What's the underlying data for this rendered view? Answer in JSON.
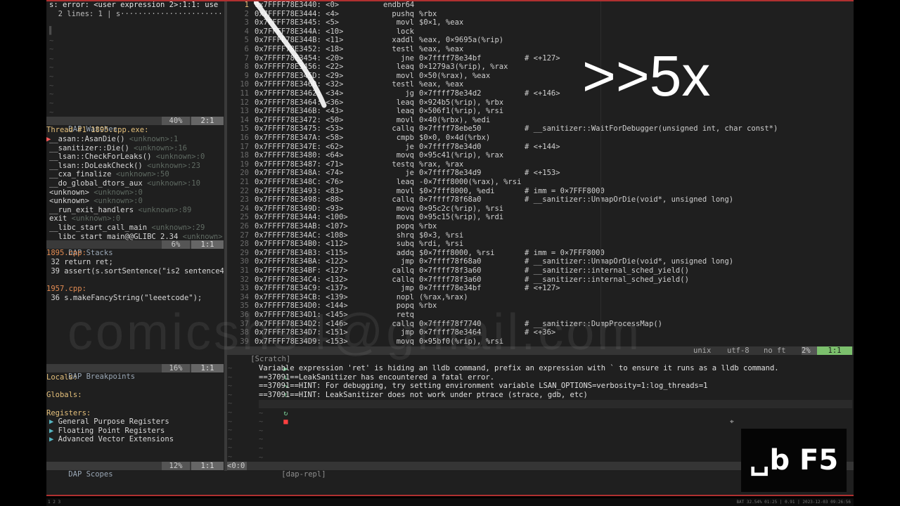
{
  "left_top": {
    "header": "s: error: <user expression 2>:1:1: use",
    "header2": "  2 lines: 1 | s·······················"
  },
  "watches": {
    "title": "DAP Watches",
    "pct": "40%",
    "pos": "2:1",
    "thread": "Thread #1 1895.cpp.exe:",
    "frames": [
      {
        "name": "__asan::AsanDie()",
        "loc": "<unknown>:1"
      },
      {
        "name": "__sanitizer::Die()",
        "loc": "<unknown>:16"
      },
      {
        "name": "__lsan::CheckForLeaks()",
        "loc": "<unknown>:0"
      },
      {
        "name": "__lsan::DoLeakCheck()",
        "loc": "<unknown>:23"
      },
      {
        "name": "__cxa_finalize",
        "loc": "<unknown>:50"
      },
      {
        "name": "__do_global_dtors_aux",
        "loc": "<unknown>:10"
      },
      {
        "name": "<unknown>",
        "loc": "<unknown>:0"
      },
      {
        "name": "<unknown>",
        "loc": "<unknown>:0"
      },
      {
        "name": "__run_exit_handlers",
        "loc": "<unknown>:89"
      },
      {
        "name": "exit",
        "loc": "<unknown>:0"
      },
      {
        "name": "__libc_start_call_main",
        "loc": "<unknown>:29"
      },
      {
        "name": "__libc_start_main@@GLIBC_2.34",
        "loc": "<unknown>"
      }
    ]
  },
  "stacks": {
    "title": "DAP Stacks",
    "pct": "6%",
    "pos": "1:1",
    "file1": "1895.cpp:",
    "l1": " 32 return ret;",
    "l2": " 39 assert(s.sortSentence(\"is2 sentence4",
    "file2": "1957.cpp:",
    "l3": " 36 s.makeFancyString(\"leeetcode\");"
  },
  "breakpoints": {
    "title": "DAP Breakpoints",
    "pct": "16%",
    "pos": "1:1",
    "locals": "Locals:",
    "globals": "Globals:",
    "registers": "Registers:",
    "reg_items": [
      "General Purpose Registers",
      "Floating Point Registers",
      "Advanced Vector Extensions"
    ]
  },
  "scopes": {
    "title": "DAP Scopes",
    "pct": "12%",
    "pos": "1:1",
    "small": "<0:0"
  },
  "disasm": {
    "lines": [
      {
        "n": "1",
        "addr": "0x7FFFF78E3440: <0>",
        "instr": "endbr64",
        "ops": "",
        "cmt": ""
      },
      {
        "n": "2",
        "addr": "0x7FFFF78E3444: <4>",
        "instr": "pushq",
        "ops": "%rbx",
        "cmt": ""
      },
      {
        "n": "3",
        "addr": "0x7FFFF78E3445: <5>",
        "instr": "movl",
        "ops": "$0×1, %eax",
        "cmt": ""
      },
      {
        "n": "4",
        "addr": "0x7FFFF78E344A: <10>",
        "instr": "lock",
        "ops": "",
        "cmt": ""
      },
      {
        "n": "5",
        "addr": "0x7FFFF78E344B: <11>",
        "instr": "xaddl",
        "ops": "%eax, 0×9695a(%rip)",
        "cmt": ""
      },
      {
        "n": "6",
        "addr": "0x7FFFF78E3452: <18>",
        "instr": "testl",
        "ops": "%eax, %eax",
        "cmt": ""
      },
      {
        "n": "7",
        "addr": "0x7FFFF78E3454: <20>",
        "instr": "jne",
        "ops": "0×7ffff78e34bf",
        "cmt": "# <+127>"
      },
      {
        "n": "8",
        "addr": "0x7FFFF78E3456: <22>",
        "instr": "leaq",
        "ops": "0×1279a3(%rip), %rax",
        "cmt": ""
      },
      {
        "n": "9",
        "addr": "0x7FFFF78E345D: <29>",
        "instr": "movl",
        "ops": "0×50(%rax), %eax",
        "cmt": ""
      },
      {
        "n": "10",
        "addr": "0x7FFFF78E3460: <32>",
        "instr": "testl",
        "ops": "%eax, %eax",
        "cmt": ""
      },
      {
        "n": "11",
        "addr": "0x7FFFF78E3462: <34>",
        "instr": "jg",
        "ops": "0×7ffff78e34d2",
        "cmt": "# <+146>"
      },
      {
        "n": "12",
        "addr": "0x7FFFF78E3464: <36>",
        "instr": "leaq",
        "ops": "0×924b5(%rip), %rbx",
        "cmt": ""
      },
      {
        "n": "13",
        "addr": "0x7FFFF78E346B: <43>",
        "instr": "leaq",
        "ops": "0×506f1(%rip), %rsi",
        "cmt": ""
      },
      {
        "n": "14",
        "addr": "0x7FFFF78E3472: <50>",
        "instr": "movl",
        "ops": "0×40(%rbx), %edi",
        "cmt": ""
      },
      {
        "n": "15",
        "addr": "0x7FFFF78E3475: <53>",
        "instr": "callq",
        "ops": "0×7ffff78ebe50",
        "cmt": "# __sanitizer::WaitForDebugger(unsigned int, char const*)"
      },
      {
        "n": "16",
        "addr": "0x7FFFF78E347A: <58>",
        "instr": "cmpb",
        "ops": "$0×0, 0×4d(%rbx)",
        "cmt": ""
      },
      {
        "n": "17",
        "addr": "0x7FFFF78E347E: <62>",
        "instr": "je",
        "ops": "0×7ffff78e34d0",
        "cmt": "# <+144>"
      },
      {
        "n": "18",
        "addr": "0x7FFFF78E3480: <64>",
        "instr": "movq",
        "ops": "0×95c41(%rip), %rax",
        "cmt": ""
      },
      {
        "n": "19",
        "addr": "0x7FFFF78E3487: <71>",
        "instr": "testq",
        "ops": "%rax, %rax",
        "cmt": ""
      },
      {
        "n": "20",
        "addr": "0x7FFFF78E348A: <74>",
        "instr": "je",
        "ops": "0×7ffff78e34d9",
        "cmt": "# <+153>"
      },
      {
        "n": "21",
        "addr": "0x7FFFF78E348C: <76>",
        "instr": "leaq",
        "ops": "-0×7fff8000(%rax), %rsi",
        "cmt": ""
      },
      {
        "n": "22",
        "addr": "0x7FFFF78E3493: <83>",
        "instr": "movl",
        "ops": "$0×7fff8000, %edi",
        "cmt": "# imm = 0×7FFF8000"
      },
      {
        "n": "23",
        "addr": "0x7FFFF78E3498: <88>",
        "instr": "callq",
        "ops": "0×7ffff78f68a0",
        "cmt": "# __sanitizer::UnmapOrDie(void*, unsigned long)"
      },
      {
        "n": "24",
        "addr": "0x7FFFF78E349D: <93>",
        "instr": "movq",
        "ops": "0×95c2c(%rip), %rsi",
        "cmt": ""
      },
      {
        "n": "25",
        "addr": "0x7FFFF78E34A4: <100>",
        "instr": "movq",
        "ops": "0×95c15(%rip), %rdi",
        "cmt": ""
      },
      {
        "n": "26",
        "addr": "0x7FFFF78E34AB: <107>",
        "instr": "popq",
        "ops": "%rbx",
        "cmt": ""
      },
      {
        "n": "27",
        "addr": "0x7FFFF78E34AC: <108>",
        "instr": "shrq",
        "ops": "$0×3, %rsi",
        "cmt": ""
      },
      {
        "n": "28",
        "addr": "0x7FFFF78E34B0: <112>",
        "instr": "subq",
        "ops": "%rdi, %rsi",
        "cmt": ""
      },
      {
        "n": "29",
        "addr": "0x7FFFF78E34B3: <115>",
        "instr": "addq",
        "ops": "$0×7fff8000, %rsi",
        "cmt": "# imm = 0×7FFF8000"
      },
      {
        "n": "30",
        "addr": "0x7FFFF78E34BA: <122>",
        "instr": "jmp",
        "ops": "0×7ffff78f68a0",
        "cmt": "# __sanitizer::UnmapOrDie(void*, unsigned long)"
      },
      {
        "n": "31",
        "addr": "0x7FFFF78E34BF: <127>",
        "instr": "callq",
        "ops": "0×7ffff78f3a60",
        "cmt": "# __sanitizer::internal_sched_yield()"
      },
      {
        "n": "32",
        "addr": "0x7FFFF78E34C4: <132>",
        "instr": "callq",
        "ops": "0×7ffff78f3a60",
        "cmt": "# __sanitizer::internal_sched_yield()"
      },
      {
        "n": "33",
        "addr": "0x7FFFF78E34C9: <137>",
        "instr": "jmp",
        "ops": "0×7ffff78e34bf",
        "cmt": "# <+127>"
      },
      {
        "n": "34",
        "addr": "0x7FFFF78E34CB: <139>",
        "instr": "nopl",
        "ops": "(%rax,%rax)",
        "cmt": ""
      },
      {
        "n": "35",
        "addr": "0x7FFFF78E34D0: <144>",
        "instr": "popq",
        "ops": "%rbx",
        "cmt": ""
      },
      {
        "n": "36",
        "addr": "0x7FFFF78E34D1: <145>",
        "instr": "retq",
        "ops": "",
        "cmt": ""
      },
      {
        "n": "37",
        "addr": "0x7FFFF78E34D2: <146>",
        "instr": "callq",
        "ops": "0×7ffff78f7740",
        "cmt": "# __sanitizer::DumpProcessMap()"
      },
      {
        "n": "38",
        "addr": "0x7FFFF78E34D7: <151>",
        "instr": "jmp",
        "ops": "0×7ffff78e3464",
        "cmt": "# <+36>"
      },
      {
        "n": "39",
        "addr": "0x7FFFF78E34D9: <153>",
        "instr": "movq",
        "ops": "0×95bf0(%rip), %rsi",
        "cmt": ""
      }
    ]
  },
  "editor_status": {
    "name": "[Scratch]",
    "fileformat": "unix",
    "encoding": "utf-8",
    "filetype": "no ft",
    "pct": "2%",
    "pos": "1:1"
  },
  "repl": {
    "lines": [
      "Variable expression 'ret' is hiding an lldb command, prefix an expression with ` to ensure it runs as a lldb command.",
      "==37091==LeakSanitizer has encountered a fatal error.",
      "==37091==HINT: For debugging, try setting environment variable LSAN_OPTIONS=verbosity=1:log_threads=1",
      "==37091==HINT: LeakSanitizer does not work under ptrace (strace, gdb, etc)"
    ],
    "status": "[dap-repl]"
  },
  "overlay": {
    "speed": ">>5x",
    "keys": "␣b F5",
    "watermark": "comicshs4@gmail.com"
  },
  "tmux": {
    "left": "1 2 3",
    "right": "BAT 32.54% 01:25 | 0.91 | 2023-12-03 09:26:56"
  }
}
